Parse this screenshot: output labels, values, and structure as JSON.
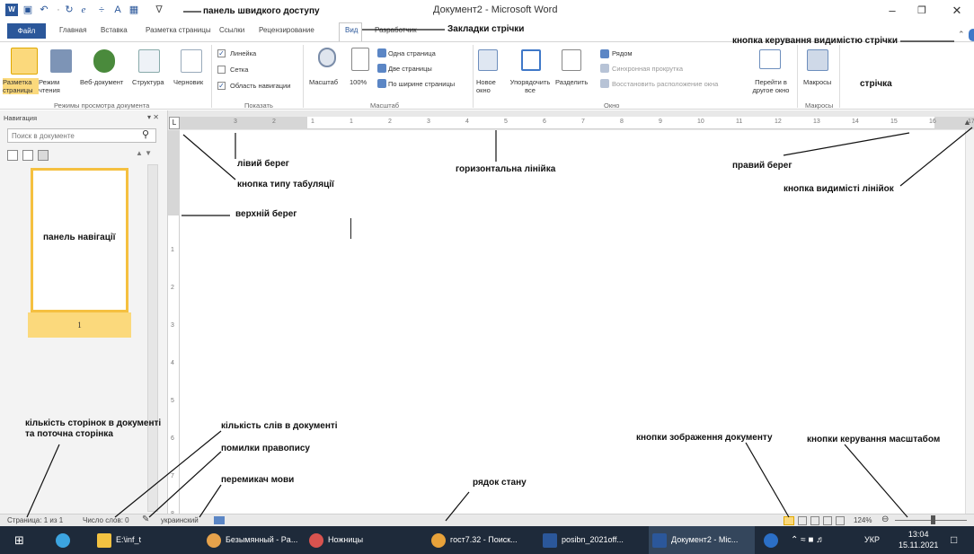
{
  "window": {
    "title": "Документ2 - Microsoft Word"
  },
  "tabs": [
    "Файл",
    "Главная",
    "Вставка",
    "Разметка страницы",
    "Ссылки",
    "Рецензирование",
    "Вид",
    "Разработчик"
  ],
  "ribbon": {
    "views": [
      "Разметка страницы",
      "Режим чтения",
      "Веб-документ",
      "Структура",
      "Черновик"
    ],
    "views_group": "Режимы просмотра документа",
    "show": [
      "Линейка",
      "Сетка",
      "Область навигации"
    ],
    "show_group": "Показать",
    "zoom": [
      "Масштаб",
      "100%",
      "Одна страница",
      "Две страницы",
      "По ширине страницы"
    ],
    "zoom_group": "Масштаб",
    "window": [
      "Новое окно",
      "Упорядочить все",
      "Разделить",
      "Рядом",
      "Синхронная прокрутка",
      "Восстановить расположение окна",
      "Перейти в другое окно"
    ],
    "window_group": "Окно",
    "macros": "Макросы",
    "macros_group": "Макросы"
  },
  "nav": {
    "title": "Навигация",
    "search_placeholder": "Поиск в документе",
    "page_number": "1"
  },
  "ruler_numbers": [
    "3",
    "2",
    "1",
    "1",
    "2",
    "3",
    "4",
    "5",
    "6",
    "7",
    "8",
    "9",
    "10",
    "11",
    "12",
    "13",
    "14",
    "15",
    "16",
    "17"
  ],
  "vruler_numbers": [
    "1",
    "2",
    "3",
    "4",
    "5",
    "6",
    "7",
    "8"
  ],
  "status": {
    "page": "Страница: 1 из 1",
    "words": "Число слов: 0",
    "language": "украинский",
    "zoom": "124%"
  },
  "taskbar": {
    "items": [
      "E:\\inf_t",
      "Безымянный - Pa...",
      "Ножницы",
      "гост7.32 - Поиск...",
      "posibn_2021off...",
      "Документ2 - Mic..."
    ],
    "lang": "УКР",
    "time": "13:04",
    "date": "15.11.2021"
  },
  "callouts": {
    "quick_access": "панель швидкого доступу",
    "ribbon_tabs": "Закладки стрічки",
    "ribbon_visibility": "кнопка керування видимістю стрічки",
    "ribbon": "стрічка",
    "left_margin": "лівий берег",
    "tab_type": "кнопка типу табуляції",
    "h_ruler": "горизонтальна лінійка",
    "right_margin": "правий берег",
    "ruler_visibility": "кнопка видимісті лінійок",
    "top_margin": "верхній берег",
    "nav_pane": "панель навігації",
    "page_count": "кількість сторінок в документі\nта поточна сторінка",
    "word_count": "кількість слів в документі",
    "spelling": "помилки правопису",
    "lang_switch": "перемикач мови",
    "status_bar": "рядок стану",
    "view_buttons": "кнопки зображення документу",
    "zoom_buttons": "кнопки керування масштабом"
  }
}
